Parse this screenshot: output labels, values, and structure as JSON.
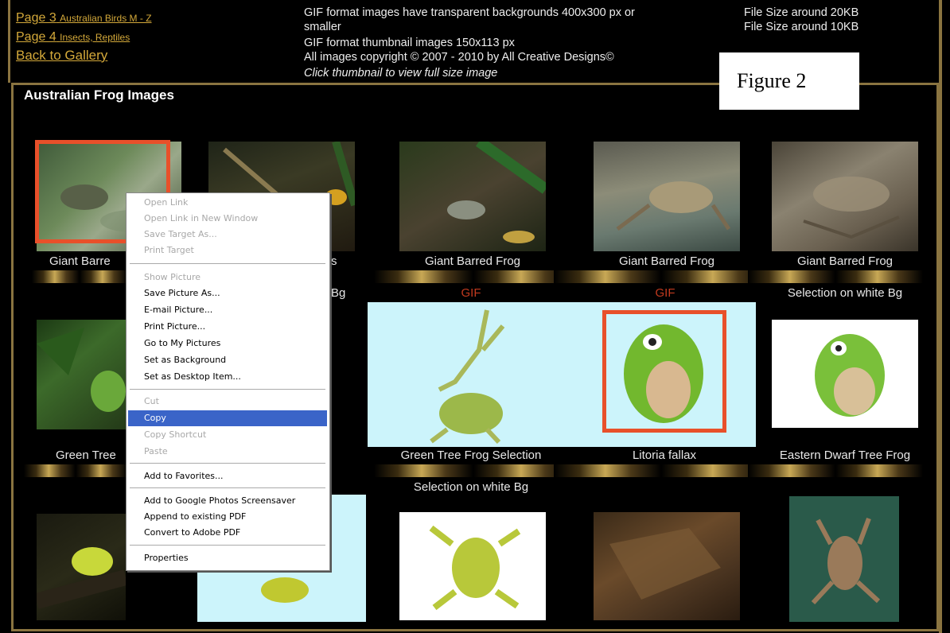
{
  "nav": {
    "page3_label": "Page 3",
    "page3_sub": "Australian Birds M - Z",
    "page4_label": "Page 4",
    "page4_sub": "Insects, Reptiles",
    "back_label": "Back to Gallery"
  },
  "info": {
    "line1": "GIF format images have transparent backgrounds 400x300 px or",
    "line2": "smaller",
    "line3": "GIF format thumbnail images 150x113 px",
    "line4": "All images copyright © 2007 - 2010 by All Creative Designs©",
    "line5": "Click thumbnail to view full size image",
    "size1": "File Size around 20KB",
    "size2": "File Size around 10KB"
  },
  "figure_label": "Figure 2",
  "panel_title": "Australian Frog Images",
  "row1": {
    "captions": [
      "Giant Barre",
      "s",
      "Giant Barred Frog",
      "Giant Barred Frog",
      "Giant Barred Frog"
    ],
    "sub": [
      "Bg",
      "GIF",
      "GIF",
      "Selection on white Bg"
    ]
  },
  "row2": {
    "captions": [
      "Green Tree",
      "Green Tree Frog Selection",
      "Litoria fallax",
      "Eastern Dwarf Tree Frog"
    ],
    "sub": "Selection on white Bg"
  },
  "menu": {
    "items": [
      {
        "label": "Open Link",
        "disabled": true
      },
      {
        "label": "Open Link in New Window",
        "disabled": true
      },
      {
        "label": "Save Target As...",
        "disabled": true
      },
      {
        "label": "Print Target",
        "disabled": true
      },
      {
        "label": "Show Picture",
        "disabled": true
      },
      {
        "label": "Save Picture As...",
        "disabled": false
      },
      {
        "label": "E-mail Picture...",
        "disabled": false
      },
      {
        "label": "Print Picture...",
        "disabled": false
      },
      {
        "label": "Go to My Pictures",
        "disabled": false
      },
      {
        "label": "Set as Background",
        "disabled": false
      },
      {
        "label": "Set as Desktop Item...",
        "disabled": false
      },
      {
        "label": "Cut",
        "disabled": true
      },
      {
        "label": "Copy",
        "disabled": false,
        "selected": true
      },
      {
        "label": "Copy Shortcut",
        "disabled": true
      },
      {
        "label": "Paste",
        "disabled": true
      },
      {
        "label": "Add to Favorites...",
        "disabled": false
      },
      {
        "label": "Add to Google Photos Screensaver",
        "disabled": false
      },
      {
        "label": "Append to existing PDF",
        "disabled": false
      },
      {
        "label": "Convert to Adobe PDF",
        "disabled": false
      },
      {
        "label": "Properties",
        "disabled": false
      }
    ]
  },
  "colors": {
    "accent_gold": "#d4a93a",
    "highlight_red": "#e8502a",
    "menu_selection": "#3a64c8",
    "gif_red": "#c23a1e"
  }
}
